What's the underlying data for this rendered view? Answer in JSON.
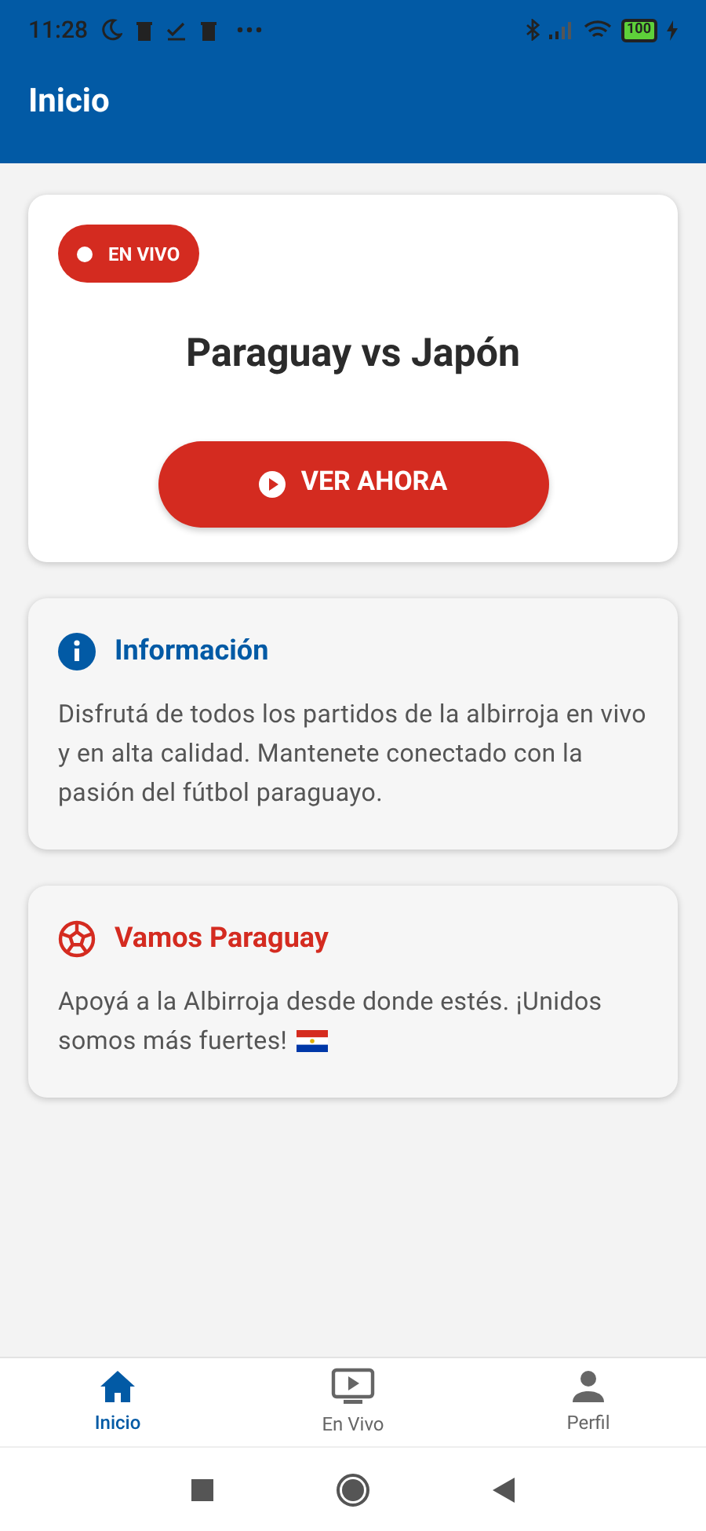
{
  "status_bar": {
    "time": "11:28",
    "battery": "100"
  },
  "app_bar": {
    "title": "Inicio"
  },
  "live_card": {
    "badge": "EN VIVO",
    "match": "Paraguay vs Japón",
    "button": "VER AHORA"
  },
  "info_cards": [
    {
      "kind": "info",
      "title": "Información",
      "body": "Disfrutá de todos los partidos de la albirroja en vivo y en alta calidad. Mantenete conectado con la pasión del fútbol paraguayo.",
      "flag": false
    },
    {
      "kind": "ball",
      "title": "Vamos Paraguay",
      "body": "Apoyá a la Albirroja desde donde estés. ¡Unidos somos más fuertes!",
      "flag": true
    }
  ],
  "tabs": [
    {
      "kind": "home",
      "label": "Inicio",
      "selected": true
    },
    {
      "kind": "tv",
      "label": "En Vivo",
      "selected": false
    },
    {
      "kind": "person",
      "label": "Perfil",
      "selected": false
    }
  ]
}
